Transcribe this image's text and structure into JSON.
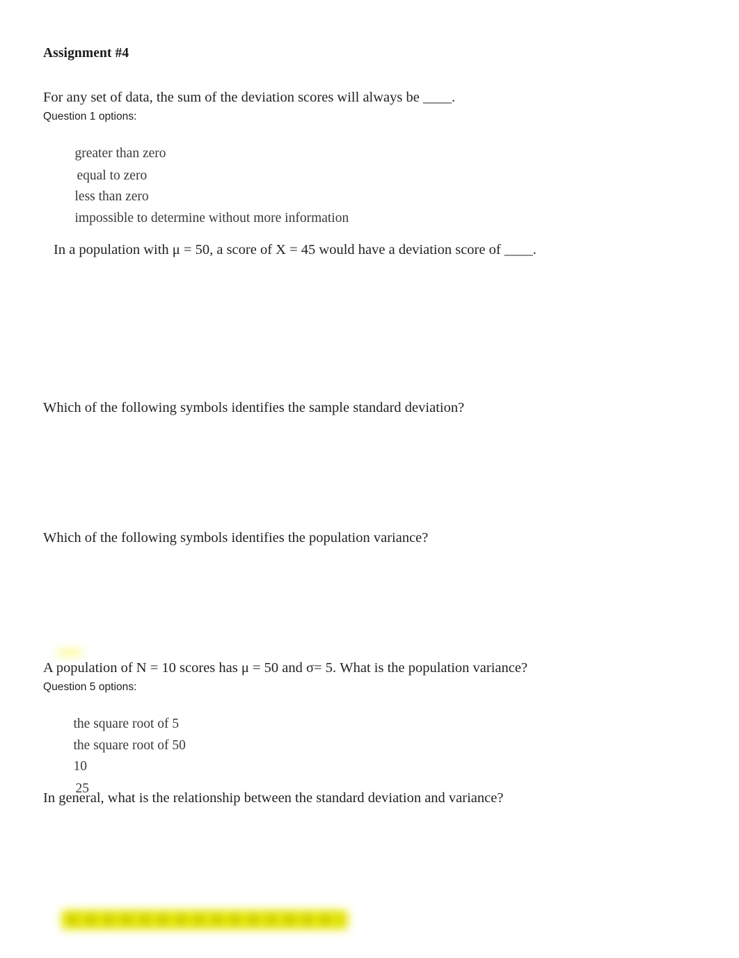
{
  "document": {
    "title": "Assignment #4",
    "highlight_color": "#f2f200",
    "text_color": "#2a2a2a"
  },
  "questions": [
    {
      "id": "q1",
      "stem": "For any set of data, the sum of the deviation scores will always be ____.",
      "options_label": "Question 1 options:",
      "options": [
        {
          "text": "greater than zero",
          "highlighted": false
        },
        {
          "text": "equal to zero",
          "highlighted": true
        },
        {
          "text": "less than zero",
          "highlighted": false
        },
        {
          "text": "impossible to determine without more information",
          "highlighted": false
        }
      ]
    },
    {
      "id": "q2",
      "stem": "In a population with μ = 50, a score of X = 45 would have a deviation score of ____.",
      "options_label": "",
      "options": []
    },
    {
      "id": "q3",
      "stem": "Which of the following symbols identifies the sample standard deviation?",
      "options_label": "",
      "options": []
    },
    {
      "id": "q4",
      "stem": "Which of the following symbols identifies the population variance?",
      "options_label": "",
      "options": []
    },
    {
      "id": "q5",
      "stem": "A population of N = 10 scores has μ = 50 and σ= 5. What is the population variance?",
      "options_label": "Question 5 options:",
      "options": [
        {
          "text": "the square root of 5",
          "highlighted": false
        },
        {
          "text": "the square root of 50",
          "highlighted": false
        },
        {
          "text": "10",
          "highlighted": false
        },
        {
          "text": "25",
          "highlighted": true
        }
      ]
    },
    {
      "id": "q6",
      "stem": "In general, what is the relationship between the standard deviation and variance?",
      "options_label": "",
      "options": []
    }
  ],
  "obscured": {
    "bottom_line_note": ""
  }
}
